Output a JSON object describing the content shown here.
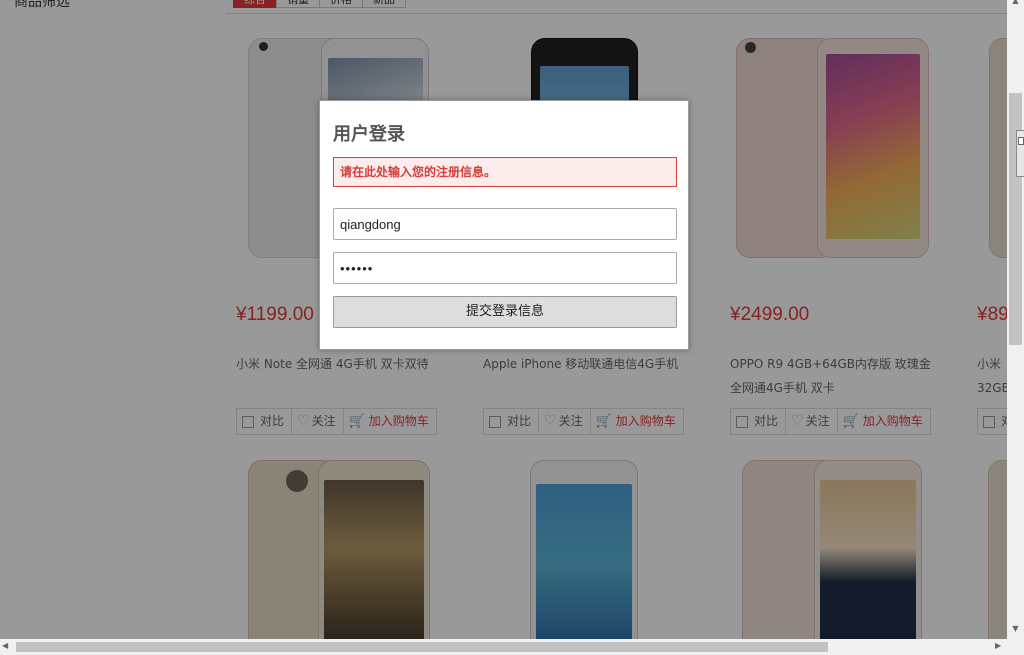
{
  "page": {
    "left_label": "商品筛选",
    "filter_tabs": [
      "综合",
      "销量",
      "价格",
      "新品"
    ]
  },
  "products_row1": [
    {
      "price": "¥1199.00",
      "name": "小米 Note 全网通 4G手机 双卡双待",
      "compare": "对比",
      "follow": "关注",
      "cart": "加入购物车"
    },
    {
      "price": "",
      "name": "Apple iPhone 移动联通电信4G手机",
      "compare": "对比",
      "follow": "关注",
      "cart": "加入购物车"
    },
    {
      "price": "¥2499.00",
      "name": "OPPO R9 4GB+64GB内存版 玫瑰金 全网通4G手机 双卡",
      "compare": "对比",
      "follow": "关注",
      "cart": "加入购物车"
    },
    {
      "price": "¥89",
      "name": "小米 32GB",
      "compare": "对",
      "follow": "",
      "cart": ""
    }
  ],
  "login": {
    "title": "用户登录",
    "alert": "请在此处输入您的注册信息。",
    "username_value": "qiangdong",
    "password_value": "••••••",
    "submit_label": "提交登录信息"
  },
  "icons": {
    "checkbox": "checkbox-icon",
    "heart": "heart-icon",
    "cart": "cart-icon"
  },
  "colors": {
    "accent": "#e4393c",
    "alert_text": "#d43f3a",
    "alert_bg": "#fcecec"
  }
}
